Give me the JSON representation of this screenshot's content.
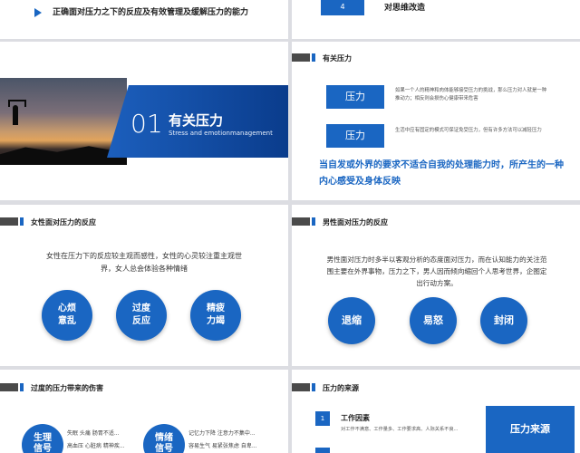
{
  "slides": {
    "top_left": {
      "text": "正确面对压力之下的反应及有效管理及缓解压力的能力"
    },
    "top_right": {
      "number": "4",
      "text": "对思维改造"
    },
    "section_cover": {
      "number": "01",
      "title": "有关压力",
      "subtitle": "Stress and emotionmanagement"
    },
    "about_stress": {
      "title": "有关压力",
      "items": [
        {
          "label": "压力",
          "description": "如果一个人的精神和肉体能够接受压力的挑战，那么压力对人就是一种推动力；相反则会损伤心健康带来危害"
        },
        {
          "label": "压力",
          "description": "生活中应有固定的模式可保证免受压力，但有许多方法可以减轻压力"
        }
      ],
      "conclusion": "当自发或外界的要求不适合自我的处理能力时，所产生的一种内心感受及身体反映"
    },
    "female": {
      "title": "女性面对压力的反应",
      "paragraph": "女性在压力下的反应较主观而感性，女性的心灵较注重主观世界，女人总会体验各种情绪",
      "reactions": [
        [
          "心烦",
          "意乱"
        ],
        [
          "过度",
          "反应"
        ],
        [
          "精疲",
          "力竭"
        ]
      ]
    },
    "male": {
      "title": "男性面对压力的反应",
      "paragraph": "男性面对压力时多半以客观分析的态度面对压力，而在认知能力的关注范围主要在外界事物，压力之下，男人因而倾向缩回个人思考世界，企图定出行动方案。",
      "reactions": [
        "退缩",
        "易怒",
        "封闭"
      ]
    },
    "harm": {
      "title": "过度的压力带来的伤害",
      "groups": [
        {
          "label": [
            "生理",
            "信号"
          ],
          "lines": [
            "失眠  头痛  肠胃不适...",
            "高血压  心脏病  精神疾..."
          ]
        },
        {
          "label": [
            "情绪",
            "信号"
          ],
          "lines": [
            "记忆力下降  注意力不集中...",
            "容易生气  易紧张焦虑  自卑..."
          ]
        }
      ]
    },
    "source": {
      "title": "压力的来源",
      "factor_number": "1",
      "factor_title": "工作因素",
      "factor_desc": "对工作不满意、工作量多、工作要求高、人际关系不良...",
      "box_label": "压力来源"
    }
  }
}
